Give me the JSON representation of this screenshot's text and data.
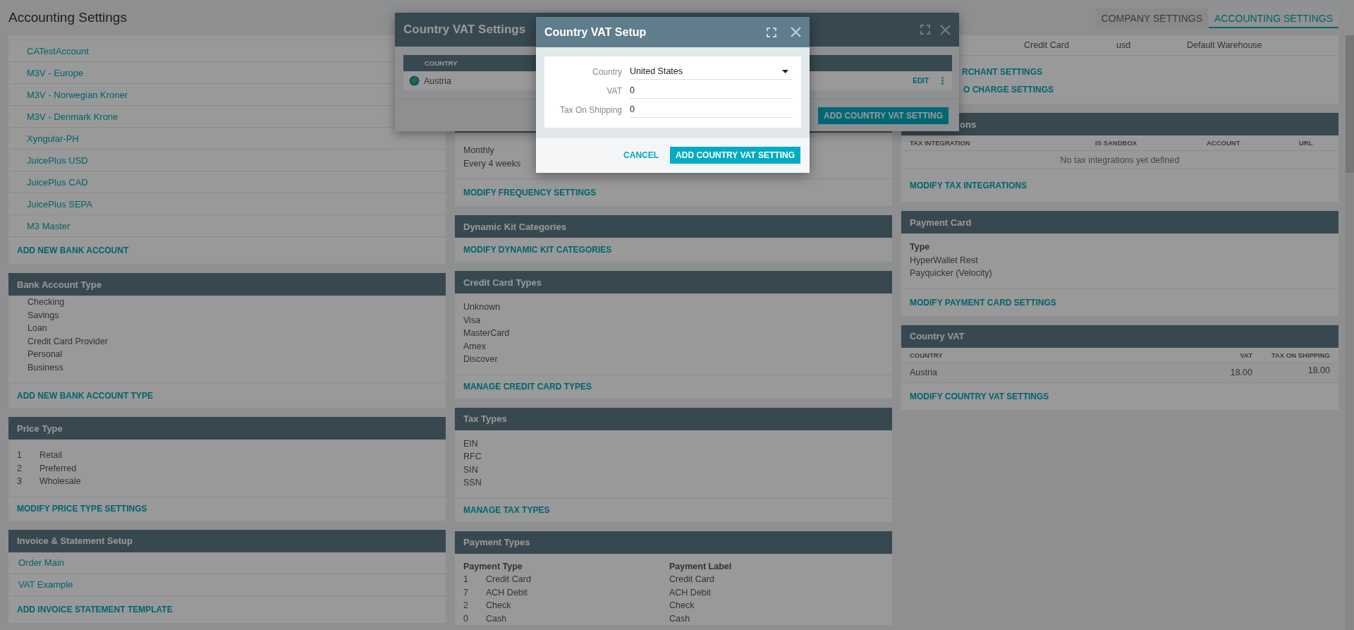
{
  "page": {
    "title": "Accounting Settings"
  },
  "tabs": [
    {
      "label": "COMPANY SETTINGS",
      "selected": false
    },
    {
      "label": "ACCOUNTING SETTINGS",
      "selected": true
    }
  ],
  "bank_accounts": {
    "items": [
      "CATestAccount",
      "M3V - Europe",
      "M3V - Norwegian Kroner",
      "M3V - Denmark Krone",
      "Xyngular-PH",
      "JuicePlus USD",
      "JuicePlus CAD",
      "JuicePlus SEPA",
      "M3 Master"
    ],
    "action": "ADD NEW BANK ACCOUNT"
  },
  "bank_account_type": {
    "title": "Bank Account Type",
    "items": [
      "Checking",
      "Savings",
      "Loan",
      "Credit Card Provider",
      "Personal",
      "Business"
    ],
    "action": "ADD NEW BANK ACCOUNT TYPE"
  },
  "price_type": {
    "title": "Price Type",
    "rows": [
      {
        "id": "1",
        "name": "Retail"
      },
      {
        "id": "2",
        "name": "Preferred"
      },
      {
        "id": "3",
        "name": "Wholesale"
      }
    ],
    "action": "MODIFY PRICE TYPE SETTINGS"
  },
  "invoice_setup": {
    "title": "Invoice & Statement Setup",
    "items": [
      "Order Main",
      "VAT Example"
    ],
    "action": "ADD INVOICE STATEMENT TEMPLATE"
  },
  "frequency": {
    "items": [
      "Monthly",
      "Every 4 weeks"
    ],
    "action": "MODIFY FREQUENCY SETTINGS"
  },
  "dynamic_kit": {
    "title": "Dynamic Kit Categories",
    "action": "MODIFY DYNAMIC KIT CATEGORIES"
  },
  "credit_card_types": {
    "title": "Credit Card Types",
    "items": [
      "Unknown",
      "Visa",
      "MasterCard",
      "Amex",
      "Discover"
    ],
    "action": "MANAGE CREDIT CARD TYPES"
  },
  "tax_types": {
    "title": "Tax Types",
    "items": [
      "EIN",
      "RFC",
      "SIN",
      "SSN"
    ],
    "action": "MANAGE TAX TYPES"
  },
  "payment_types": {
    "title": "Payment Types",
    "columns": [
      "Payment Type",
      "Payment Label"
    ],
    "rows": [
      {
        "id": "1",
        "type": "Credit Card",
        "label": "Credit Card"
      },
      {
        "id": "7",
        "type": "ACH Debit",
        "label": "ACH Debit"
      },
      {
        "id": "2",
        "type": "Check",
        "label": "Check"
      },
      {
        "id": "0",
        "type": "Cash",
        "label": "Cash"
      }
    ]
  },
  "merchant": {
    "row": [
      "Credit Card",
      "usd",
      "Default Warehouse"
    ],
    "links": [
      "RCHANT SETTINGS",
      "O CHARGE SETTINGS"
    ]
  },
  "tax_integrations": {
    "title": "ons",
    "columns": [
      "TAX INTEGRATION",
      "IS SANDBOX",
      "ACCOUNT",
      "URL"
    ],
    "empty": "No tax integrations yet defined",
    "action": "MODIFY TAX INTEGRATIONS"
  },
  "payment_card": {
    "title": "Payment Card",
    "heading": "Type",
    "items": [
      "HyperWallet Rest",
      "Payquicker (Velocity)"
    ],
    "action": "MODIFY PAYMENT CARD SETTINGS"
  },
  "country_vat": {
    "title": "Country VAT",
    "columns": [
      "COUNTRY",
      "VAT",
      "TAX ON SHIPPING"
    ],
    "rows": [
      {
        "country": "Austria",
        "vat": "18.00",
        "tax_on_shipping": "18.00"
      }
    ],
    "action": "MODIFY COUNTRY VAT SETTINGS"
  },
  "vat_settings_dialog": {
    "title": "Country VAT Settings",
    "columns": [
      "COUNTRY"
    ],
    "rows": [
      {
        "country": "Austria",
        "edit": "EDIT"
      }
    ],
    "button": "ADD COUNTRY VAT SETTING"
  },
  "vat_setup_dialog": {
    "title": "Country VAT Setup",
    "fields": [
      {
        "kind": "select",
        "label": "Country",
        "value": "United States"
      },
      {
        "kind": "text",
        "label": "VAT",
        "value": "0"
      },
      {
        "kind": "text",
        "label": "Tax On Shipping",
        "value": "0"
      }
    ],
    "cancel": "CANCEL",
    "submit": "ADD COUNTRY VAT SETTING"
  }
}
